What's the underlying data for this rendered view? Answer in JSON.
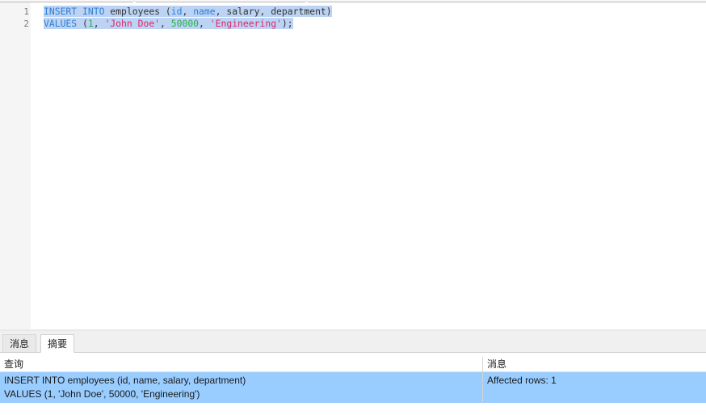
{
  "editor": {
    "line_numbers": [
      "1",
      "2"
    ],
    "line1": {
      "kw1": "INSERT",
      "sp1": " ",
      "kw2": "INTO",
      "rest1": " employees (",
      "col_id": "id",
      "sep1": ", ",
      "col_name": "name",
      "rest2": ", salary, department)"
    },
    "line2": {
      "kw": "VALUES",
      "open": " (",
      "v1": "1",
      "sep1": ", ",
      "v2": "'John Doe'",
      "sep2": ", ",
      "v3": "50000",
      "sep3": ", ",
      "v4": "'Engineering'",
      "close": ");"
    }
  },
  "tabs": [
    {
      "label": "消息",
      "active": false
    },
    {
      "label": "摘要",
      "active": true
    }
  ],
  "results": {
    "columns": [
      "查询",
      "消息"
    ],
    "rows": [
      {
        "query_line1": "INSERT INTO employees (id, name, salary, department)",
        "query_line2": "VALUES (1, 'John Doe', 50000, 'Engineering')",
        "message": "Affected rows: 1"
      }
    ]
  },
  "colors": {
    "keyword": "#2b7fd6",
    "number": "#27b04a",
    "string": "#e0246a",
    "selection": "#bcd3f4",
    "row_highlight": "#99ccff"
  }
}
